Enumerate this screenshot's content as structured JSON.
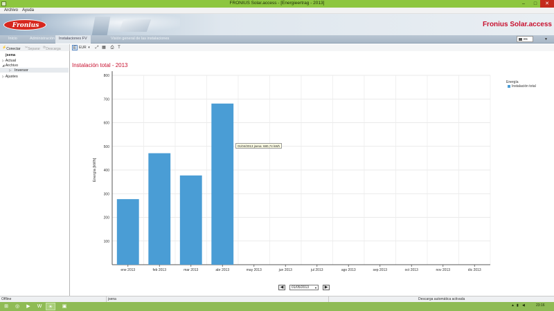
{
  "window": {
    "title": "FRONIUS Solar.access - [Energieertrag - 2013]",
    "minimize": "–",
    "maximize": "□",
    "close": "✕"
  },
  "menu": {
    "items": [
      "Archivo",
      "Ayuda"
    ]
  },
  "banner": {
    "logo_text": "Fronius",
    "brand_text": "Fronius Solar.access"
  },
  "nav": {
    "tabs": [
      "Inicio",
      "Administración",
      "Instalaciones FV",
      "Visión general de las instalaciones"
    ],
    "active_tab": "Instalaciones FV",
    "language": "es"
  },
  "left_toolbar": {
    "connect": "Conectar",
    "separate": "Separar",
    "download": "Descarga"
  },
  "chart_toolbar": {
    "icons": [
      "energy-icon",
      "tariff-icon",
      "view-icon",
      "zoom-icon",
      "table-icon",
      "print-icon",
      "text-icon"
    ]
  },
  "tree": {
    "root": "jsena",
    "items": [
      {
        "label": "Actual",
        "arrow": "▷"
      },
      {
        "label": "Archivo",
        "arrow": "◢"
      },
      {
        "label": "Inversor",
        "arrow": "▷"
      },
      {
        "label": "Ajustes",
        "arrow": "▷"
      }
    ]
  },
  "content": {
    "heading": "Instalación total - 2013"
  },
  "legend": {
    "title": "Energía",
    "item": "Instalación total"
  },
  "tooltip": {
    "text": "01/04/2013 jsena: 680,74 kWh"
  },
  "pager": {
    "date": "01/05/2013",
    "prev": "◀",
    "next": "▶"
  },
  "status": {
    "left": "Offline",
    "middle": "jsena",
    "right": "Descarga automática activada"
  },
  "taskbar": {
    "clock": "23:16"
  },
  "colors": {
    "accent": "#c8102e",
    "bar": "#4a9dd5",
    "titlebar": "#8dc63f"
  },
  "chart_data": {
    "type": "bar",
    "title": "Instalación total - 2013",
    "ylabel": "Energía [kWh]",
    "xlabel": "",
    "categories": [
      "ene 2013",
      "feb 2013",
      "mar 2013",
      "abr 2013",
      "may 2013",
      "jun 2013",
      "jul 2013",
      "ago 2013",
      "sep 2013",
      "oct 2013",
      "nov 2013",
      "dic 2013"
    ],
    "series": [
      {
        "name": "Instalación total",
        "values": [
          277,
          471,
          377,
          680.74,
          0,
          0,
          0,
          0,
          0,
          0,
          0,
          0
        ]
      }
    ],
    "ylim": [
      0,
      800
    ],
    "yticks": [
      100,
      200,
      300,
      400,
      500,
      600,
      700,
      800
    ],
    "grid": true,
    "legend": "top-right"
  }
}
